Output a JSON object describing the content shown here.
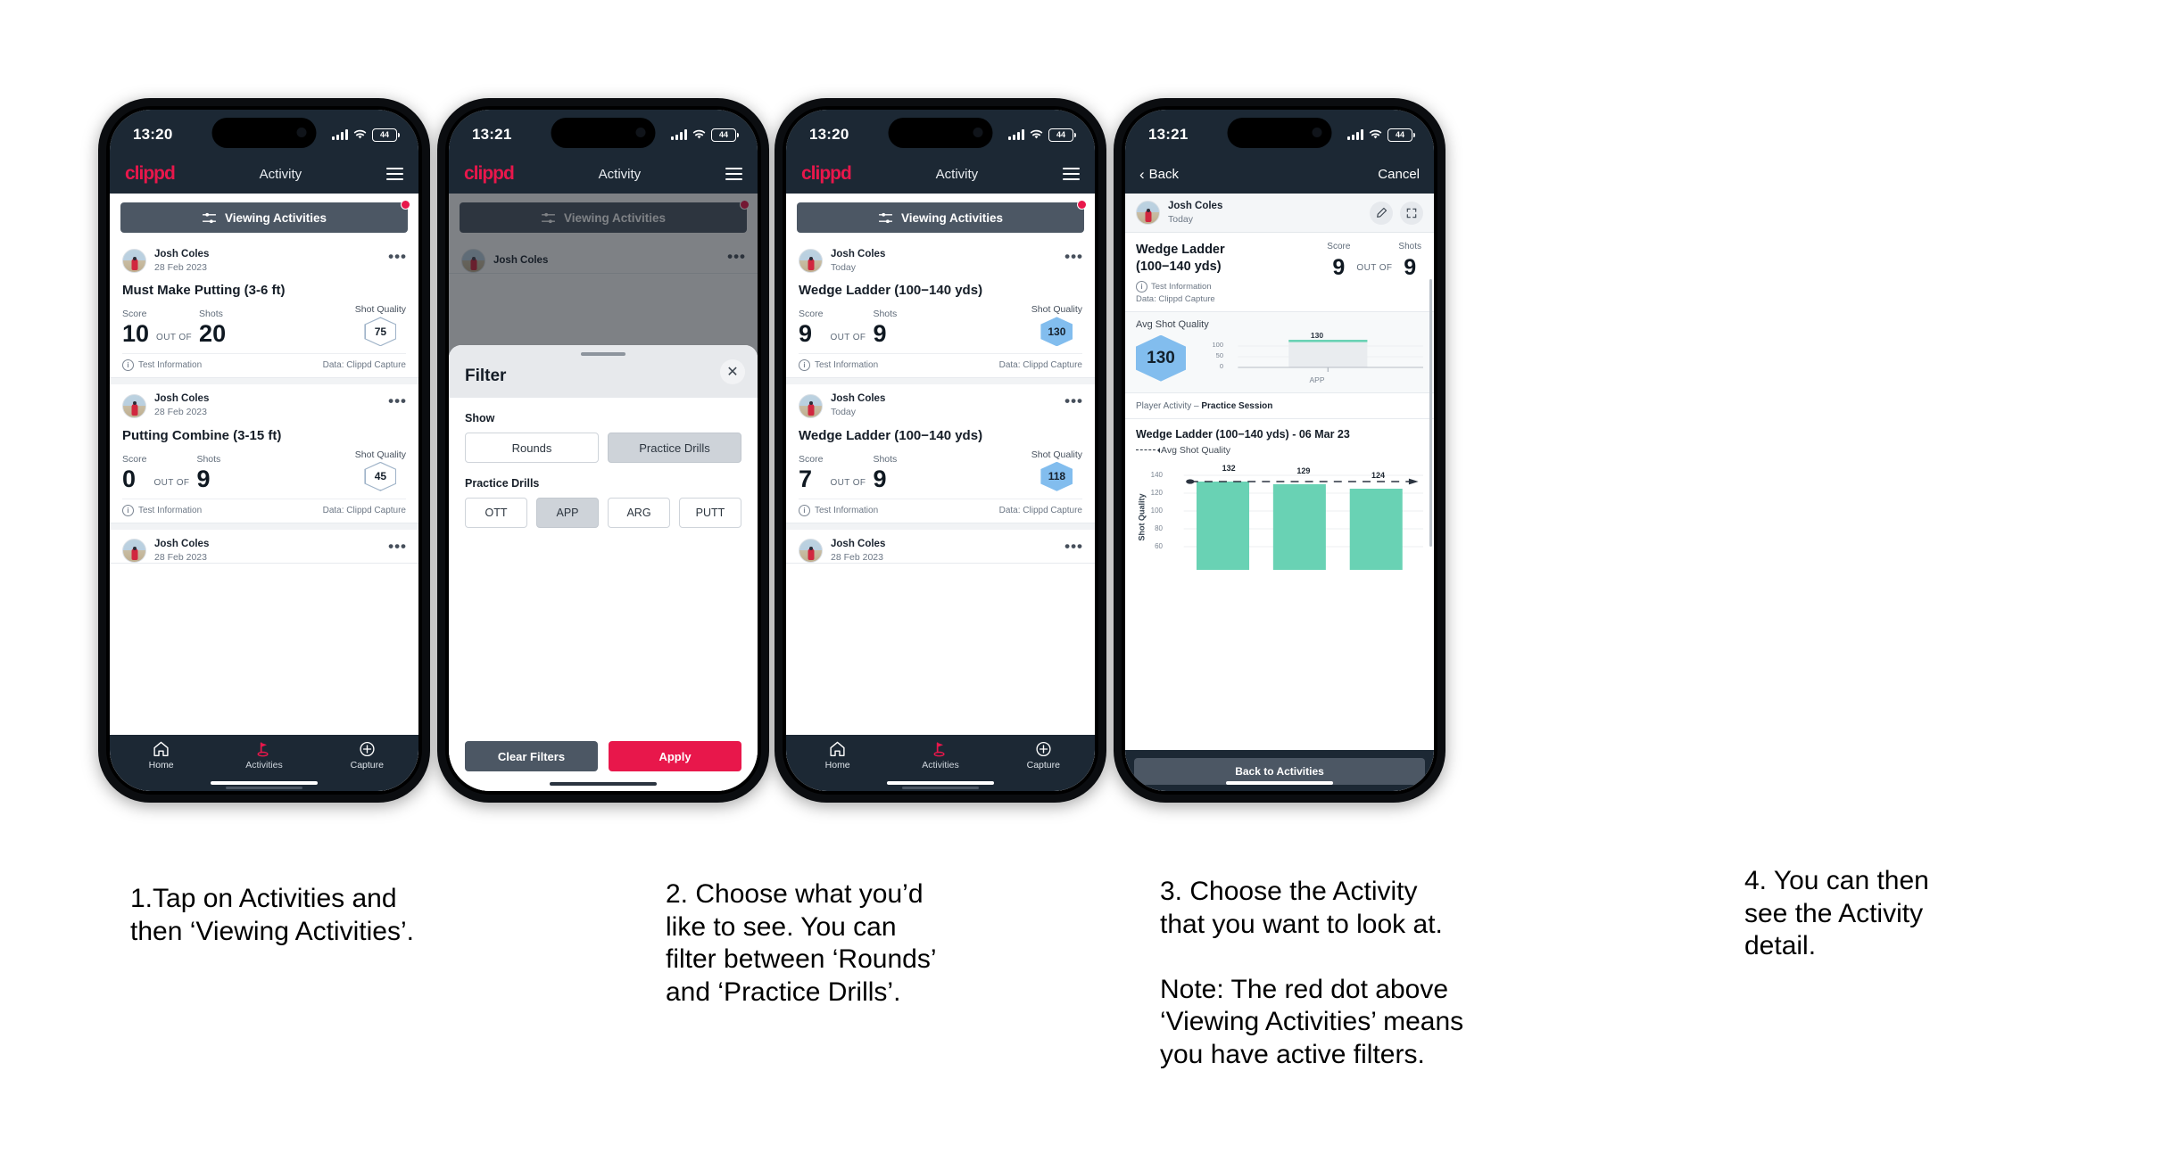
{
  "phones": [
    {
      "id": "phone-activities-list",
      "status": {
        "time": "13:20",
        "battery": "44"
      },
      "appbar": {
        "logo": "clippd",
        "title": "Activity"
      },
      "viewing_button": {
        "label": "Viewing Activities",
        "has_red_dot": true
      },
      "cards": [
        {
          "user": "Josh Coles",
          "date": "28 Feb 2023",
          "title": "Must Make Putting (3-6 ft)",
          "score_label": "Score",
          "score_value": "10",
          "out_of": "OUT OF",
          "shots_label": "Shots",
          "shots_value": "20",
          "quality_label": "Shot Quality",
          "quality_value": "75",
          "quality_filled": false,
          "footer_left": "Test Information",
          "footer_right": "Data: Clippd Capture"
        },
        {
          "user": "Josh Coles",
          "date": "28 Feb 2023",
          "title": "Putting Combine (3-15 ft)",
          "score_label": "Score",
          "score_value": "0",
          "out_of": "OUT OF",
          "shots_label": "Shots",
          "shots_value": "9",
          "quality_label": "Shot Quality",
          "quality_value": "45",
          "quality_filled": false,
          "footer_left": "Test Information",
          "footer_right": "Data: Clippd Capture"
        },
        {
          "user": "Josh Coles",
          "date": "28 Feb 2023",
          "title": "",
          "score_label": "",
          "score_value": "",
          "out_of": "",
          "shots_label": "",
          "shots_value": "",
          "quality_label": "",
          "quality_value": "",
          "quality_filled": false,
          "footer_left": "",
          "footer_right": ""
        }
      ],
      "nav": [
        {
          "label": "Home",
          "icon": "home-icon",
          "active": false
        },
        {
          "label": "Activities",
          "icon": "golf-flag-icon",
          "active": true
        },
        {
          "label": "Capture",
          "icon": "plus-circle-icon",
          "active": false
        }
      ]
    },
    {
      "id": "phone-filter-sheet",
      "status": {
        "time": "13:21",
        "battery": "44"
      },
      "appbar": {
        "logo": "clippd",
        "title": "Activity"
      },
      "viewing_button": {
        "label": "Viewing Activities",
        "has_red_dot": true
      },
      "behind_card_user": "Josh Coles",
      "sheet": {
        "title": "Filter",
        "show_label": "Show",
        "show_options": [
          {
            "label": "Rounds",
            "selected": false
          },
          {
            "label": "Practice Drills",
            "selected": true
          }
        ],
        "drills_label": "Practice Drills",
        "drill_options": [
          {
            "label": "OTT",
            "selected": false
          },
          {
            "label": "APP",
            "selected": true
          },
          {
            "label": "ARG",
            "selected": false
          },
          {
            "label": "PUTT",
            "selected": false
          }
        ],
        "clear_label": "Clear Filters",
        "apply_label": "Apply"
      }
    },
    {
      "id": "phone-wedge-ladder-list",
      "status": {
        "time": "13:20",
        "battery": "44"
      },
      "appbar": {
        "logo": "clippd",
        "title": "Activity"
      },
      "viewing_button": {
        "label": "Viewing Activities",
        "has_red_dot": true
      },
      "cards": [
        {
          "user": "Josh Coles",
          "date": "Today",
          "title": "Wedge Ladder (100−140 yds)",
          "score_label": "Score",
          "score_value": "9",
          "out_of": "OUT OF",
          "shots_label": "Shots",
          "shots_value": "9",
          "quality_label": "Shot Quality",
          "quality_value": "130",
          "quality_filled": true,
          "footer_left": "Test Information",
          "footer_right": "Data: Clippd Capture"
        },
        {
          "user": "Josh Coles",
          "date": "Today",
          "title": "Wedge Ladder (100−140 yds)",
          "score_label": "Score",
          "score_value": "7",
          "out_of": "OUT OF",
          "shots_label": "Shots",
          "shots_value": "9",
          "quality_label": "Shot Quality",
          "quality_value": "118",
          "quality_filled": true,
          "footer_left": "Test Information",
          "footer_right": "Data: Clippd Capture"
        },
        {
          "user": "Josh Coles",
          "date": "28 Feb 2023",
          "title": "",
          "score_label": "",
          "score_value": "",
          "out_of": "",
          "shots_label": "",
          "shots_value": "",
          "quality_label": "",
          "quality_value": "",
          "quality_filled": false,
          "footer_left": "",
          "footer_right": ""
        }
      ],
      "nav": [
        {
          "label": "Home",
          "icon": "home-icon",
          "active": false
        },
        {
          "label": "Activities",
          "icon": "golf-flag-icon",
          "active": true
        },
        {
          "label": "Capture",
          "icon": "plus-circle-icon",
          "active": false
        }
      ]
    },
    {
      "id": "phone-activity-detail",
      "status": {
        "time": "13:21",
        "battery": "44"
      },
      "backbar": {
        "back_label": "Back",
        "cancel_label": "Cancel"
      },
      "detail": {
        "user": "Josh Coles",
        "date": "Today",
        "edit_icon": "pencil-icon",
        "expand_icon": "expand-icon",
        "title": "Wedge Ladder (100−140 yds)",
        "test_information": "Test Information",
        "data_source": "Data: Clippd Capture",
        "score_label": "Score",
        "score_value": "9",
        "out_of": "OUT OF",
        "shots_label": "Shots",
        "shots_value": "9",
        "avg_label": "Avg Shot Quality",
        "avg_value": "130",
        "player_activity_prefix": "Player Activity – ",
        "player_activity_value": "Practice Session",
        "chart_title": "Wedge Ladder (100−140 yds) - 06 Mar 23",
        "legend_label": "Avg Shot Quality",
        "back_to_activities": "Back to Activities"
      },
      "chart_data": [
        {
          "type": "bar",
          "title": "Avg Shot Quality",
          "categories": [
            "APP"
          ],
          "values": [
            130
          ],
          "data_labels": [
            "130"
          ],
          "ylabel": "",
          "ytick_labels": [
            "0",
            "50",
            "100"
          ],
          "ylim": [
            0,
            140
          ],
          "grid": true,
          "legend": "none"
        },
        {
          "type": "bar",
          "title": "Wedge Ladder (100−140 yds) - 06 Mar 23",
          "categories": [
            "",
            "",
            ""
          ],
          "values": [
            132,
            129,
            124
          ],
          "data_labels": [
            "132",
            "129",
            "124"
          ],
          "ylabel": "Shot Quality",
          "ytick_labels": [
            "60",
            "80",
            "100",
            "120",
            "140"
          ],
          "ylim": [
            50,
            145
          ],
          "grid": true,
          "legend": "Avg Shot Quality",
          "reference_line": 132,
          "bar_color": "#69d2b4"
        }
      ]
    }
  ],
  "captions": [
    "1.Tap on Activities and\nthen ‘Viewing Activities’.",
    "2. Choose what you’d\nlike to see. You can\nfilter between ‘Rounds’\nand ‘Practice Drills’.",
    "3. Choose the Activity\nthat you want to look at.\n\nNote: The red dot above\n‘Viewing Activities’ means\nyou have active filters.",
    "4. You can then\nsee the Activity\ndetail."
  ],
  "colors": {
    "brand_red": "#e8174b",
    "dark_navy": "#1c2834",
    "slate_button": "#4c5764",
    "hex_blue": "#82bdee",
    "bar_green": "#69d2b4"
  }
}
